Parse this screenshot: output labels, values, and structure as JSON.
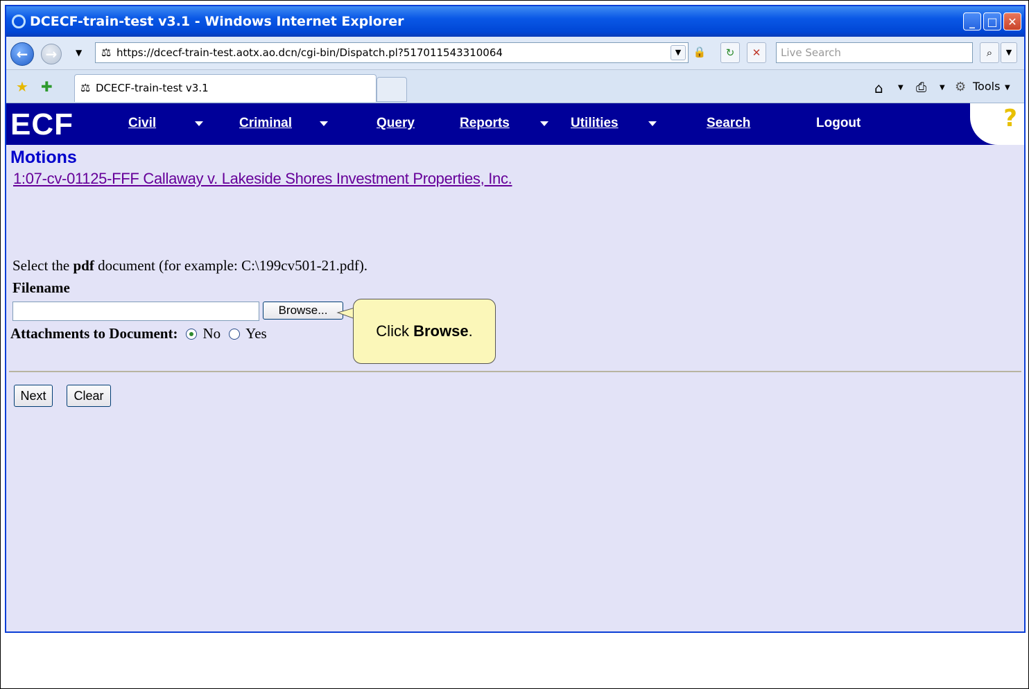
{
  "window": {
    "title": "DCECF-train-test v3.1 - Windows Internet Explorer"
  },
  "addressbar": {
    "url": "https://dcecf-train-test.aotx.ao.dcn/cgi-bin/Dispatch.pl?517011543310064",
    "search_placeholder": "Live Search"
  },
  "tabs": {
    "active_label": "DCECF-train-test v3.1",
    "tools_label": "Tools"
  },
  "ecf_nav": {
    "logo": "ECF",
    "items": [
      "Civil",
      "Criminal",
      "Query",
      "Reports",
      "Utilities",
      "Search",
      "Logout"
    ],
    "help": "?"
  },
  "page": {
    "heading": "Motions",
    "case_link": "1:07-cv-01125-FFF Callaway v. Lakeside Shores Investment Properties, Inc.",
    "instruction_pre": "Select the ",
    "instruction_bold": "pdf",
    "instruction_post": " document (for example: C:\\199cv501-21.pdf).",
    "filename_label": "Filename",
    "filename_value": "",
    "browse_label": "Browse...",
    "attachments_label": "Attachments to Document:",
    "option_no": "No",
    "option_yes": "Yes",
    "selected_option": "No",
    "next_label": "Next",
    "clear_label": "Clear"
  },
  "callout": {
    "pre": "Click ",
    "bold": "Browse",
    "post": "."
  }
}
